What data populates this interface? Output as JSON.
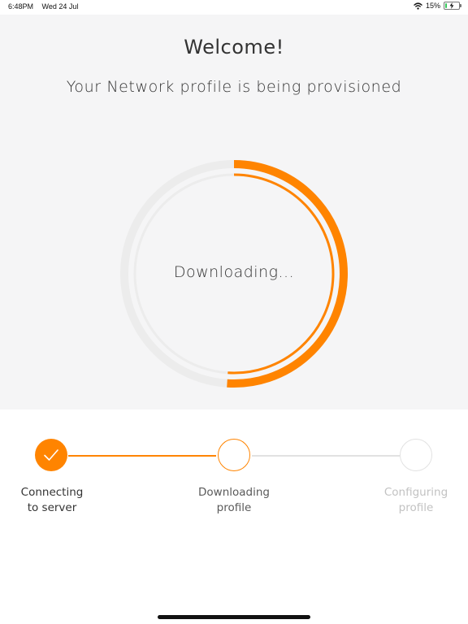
{
  "status_bar": {
    "time": "6:48PM",
    "date": "Wed 24 Jul",
    "battery_percent_label": "15%",
    "battery_level": 0.15
  },
  "header": {
    "title": "Welcome!",
    "subtitle": "Your Network profile is being provisioned"
  },
  "progress": {
    "label": "Downloading...",
    "fraction": 0.51,
    "accent_color": "#ff8400",
    "track_color": "#e9e9e9"
  },
  "steps": [
    {
      "line1": "Connecting",
      "line2": "to server",
      "state": "complete"
    },
    {
      "line1": "Downloading",
      "line2": "profile",
      "state": "active"
    },
    {
      "line1": "Configuring",
      "line2": "profile",
      "state": "pending"
    }
  ],
  "colors": {
    "accent": "#ff8400",
    "panel_background": "#f5f5f6",
    "pending_text": "#c2c2c2",
    "pending_line": "#e2e2e2"
  }
}
